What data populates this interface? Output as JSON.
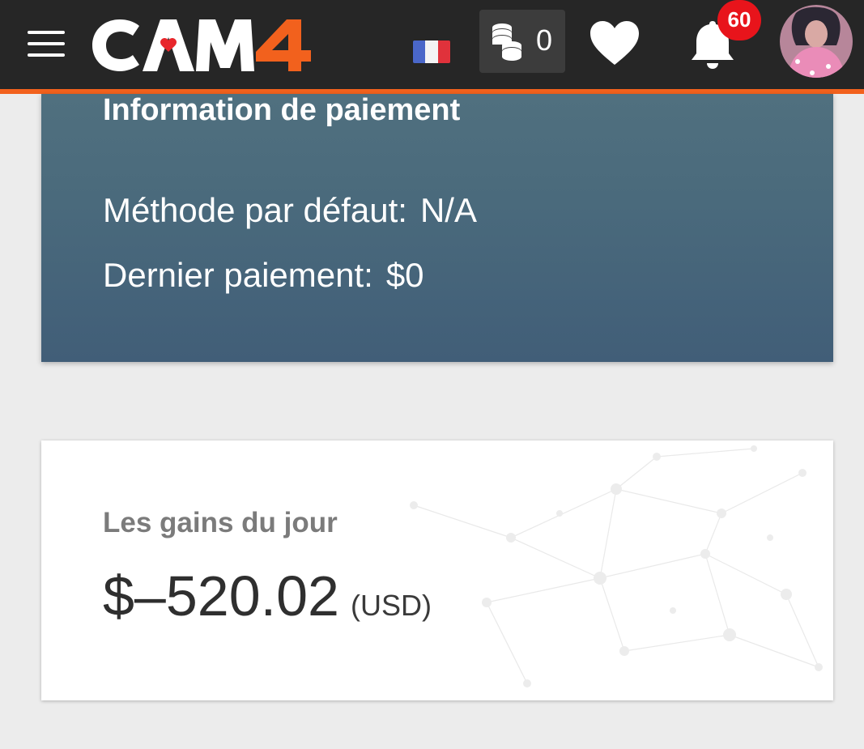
{
  "header": {
    "logo_text_main": "CA",
    "logo_text_m": "M",
    "logo_text_4": "4",
    "brand": "CAM4",
    "token_count": "0",
    "notification_count": "60",
    "accent_color": "#f2611d"
  },
  "payment": {
    "title": "Information de paiement",
    "default_method_label": "Méthode par défaut:",
    "default_method_value": "N/A",
    "last_payment_label": "Dernier paiement:",
    "last_payment_value": "$0"
  },
  "earnings": {
    "label": "Les gains du jour",
    "value": "$–520.02",
    "currency": "(USD)"
  }
}
